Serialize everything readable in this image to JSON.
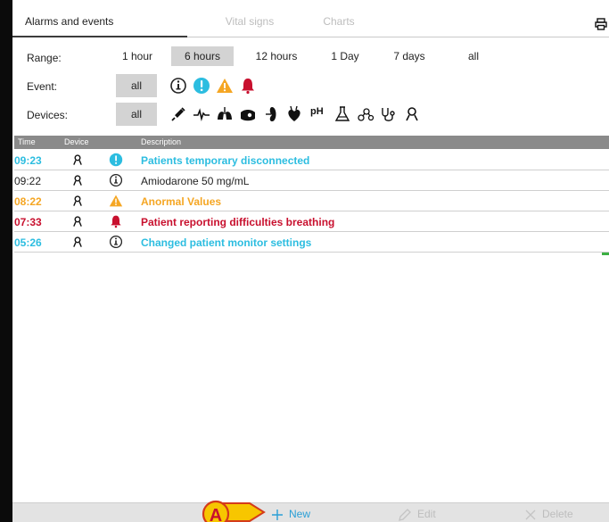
{
  "tabs": [
    {
      "label": "Alarms and events",
      "active": true
    },
    {
      "label": "Vital signs",
      "active": false
    },
    {
      "label": "Charts",
      "active": false
    }
  ],
  "filters": {
    "range_label": "Range:",
    "range_options": [
      "1 hour",
      "6 hours",
      "12 hours",
      "1 Day",
      "7 days",
      "all"
    ],
    "range_selected": "6 hours",
    "event_label": "Event:",
    "event_all": "all",
    "event_icons": [
      "info-icon",
      "notification-icon",
      "warning-icon",
      "alarm-bell-icon"
    ],
    "devices_label": "Devices:",
    "devices_all": "all",
    "device_icons": [
      "syringe-icon",
      "ecg-icon",
      "lungs-icon",
      "ventilator-icon",
      "kidney-icon",
      "heart-icon",
      "ph-icon",
      "lab-flask-icon",
      "molecule-icon",
      "stethoscope-icon",
      "person-icon"
    ],
    "ph_text": "pH"
  },
  "table": {
    "headers": {
      "time": "Time",
      "device": "Device",
      "description": "Description"
    },
    "rows": [
      {
        "time": "09:23",
        "device_icon": "person-icon",
        "severity_icon": "notification-icon",
        "description": "Patients temporary disconnected",
        "color": "#2cbde0"
      },
      {
        "time": "09:22",
        "device_icon": "person-icon",
        "severity_icon": "info-icon",
        "description": "Amiodarone 50 mg/mL",
        "color": "#222222"
      },
      {
        "time": "08:22",
        "device_icon": "person-icon",
        "severity_icon": "warning-icon",
        "description": "Anormal Values",
        "color": "#f5a623"
      },
      {
        "time": "07:33",
        "device_icon": "person-icon",
        "severity_icon": "alarm-bell-icon",
        "description": "Patient reporting difficulties breathing",
        "color": "#c8102e"
      },
      {
        "time": "05:26",
        "device_icon": "person-icon",
        "severity_icon": "info-icon",
        "description": "Changed patient monitor settings",
        "color": "#2cbde0"
      }
    ]
  },
  "bottom": {
    "new_label": "New",
    "edit_label": "Edit",
    "delete_label": "Delete"
  },
  "callout_label": "A",
  "colors": {
    "accent_blue": "#2cbde0",
    "warning": "#f5a623",
    "alarm": "#c8102e",
    "callout": "#f7c600"
  }
}
